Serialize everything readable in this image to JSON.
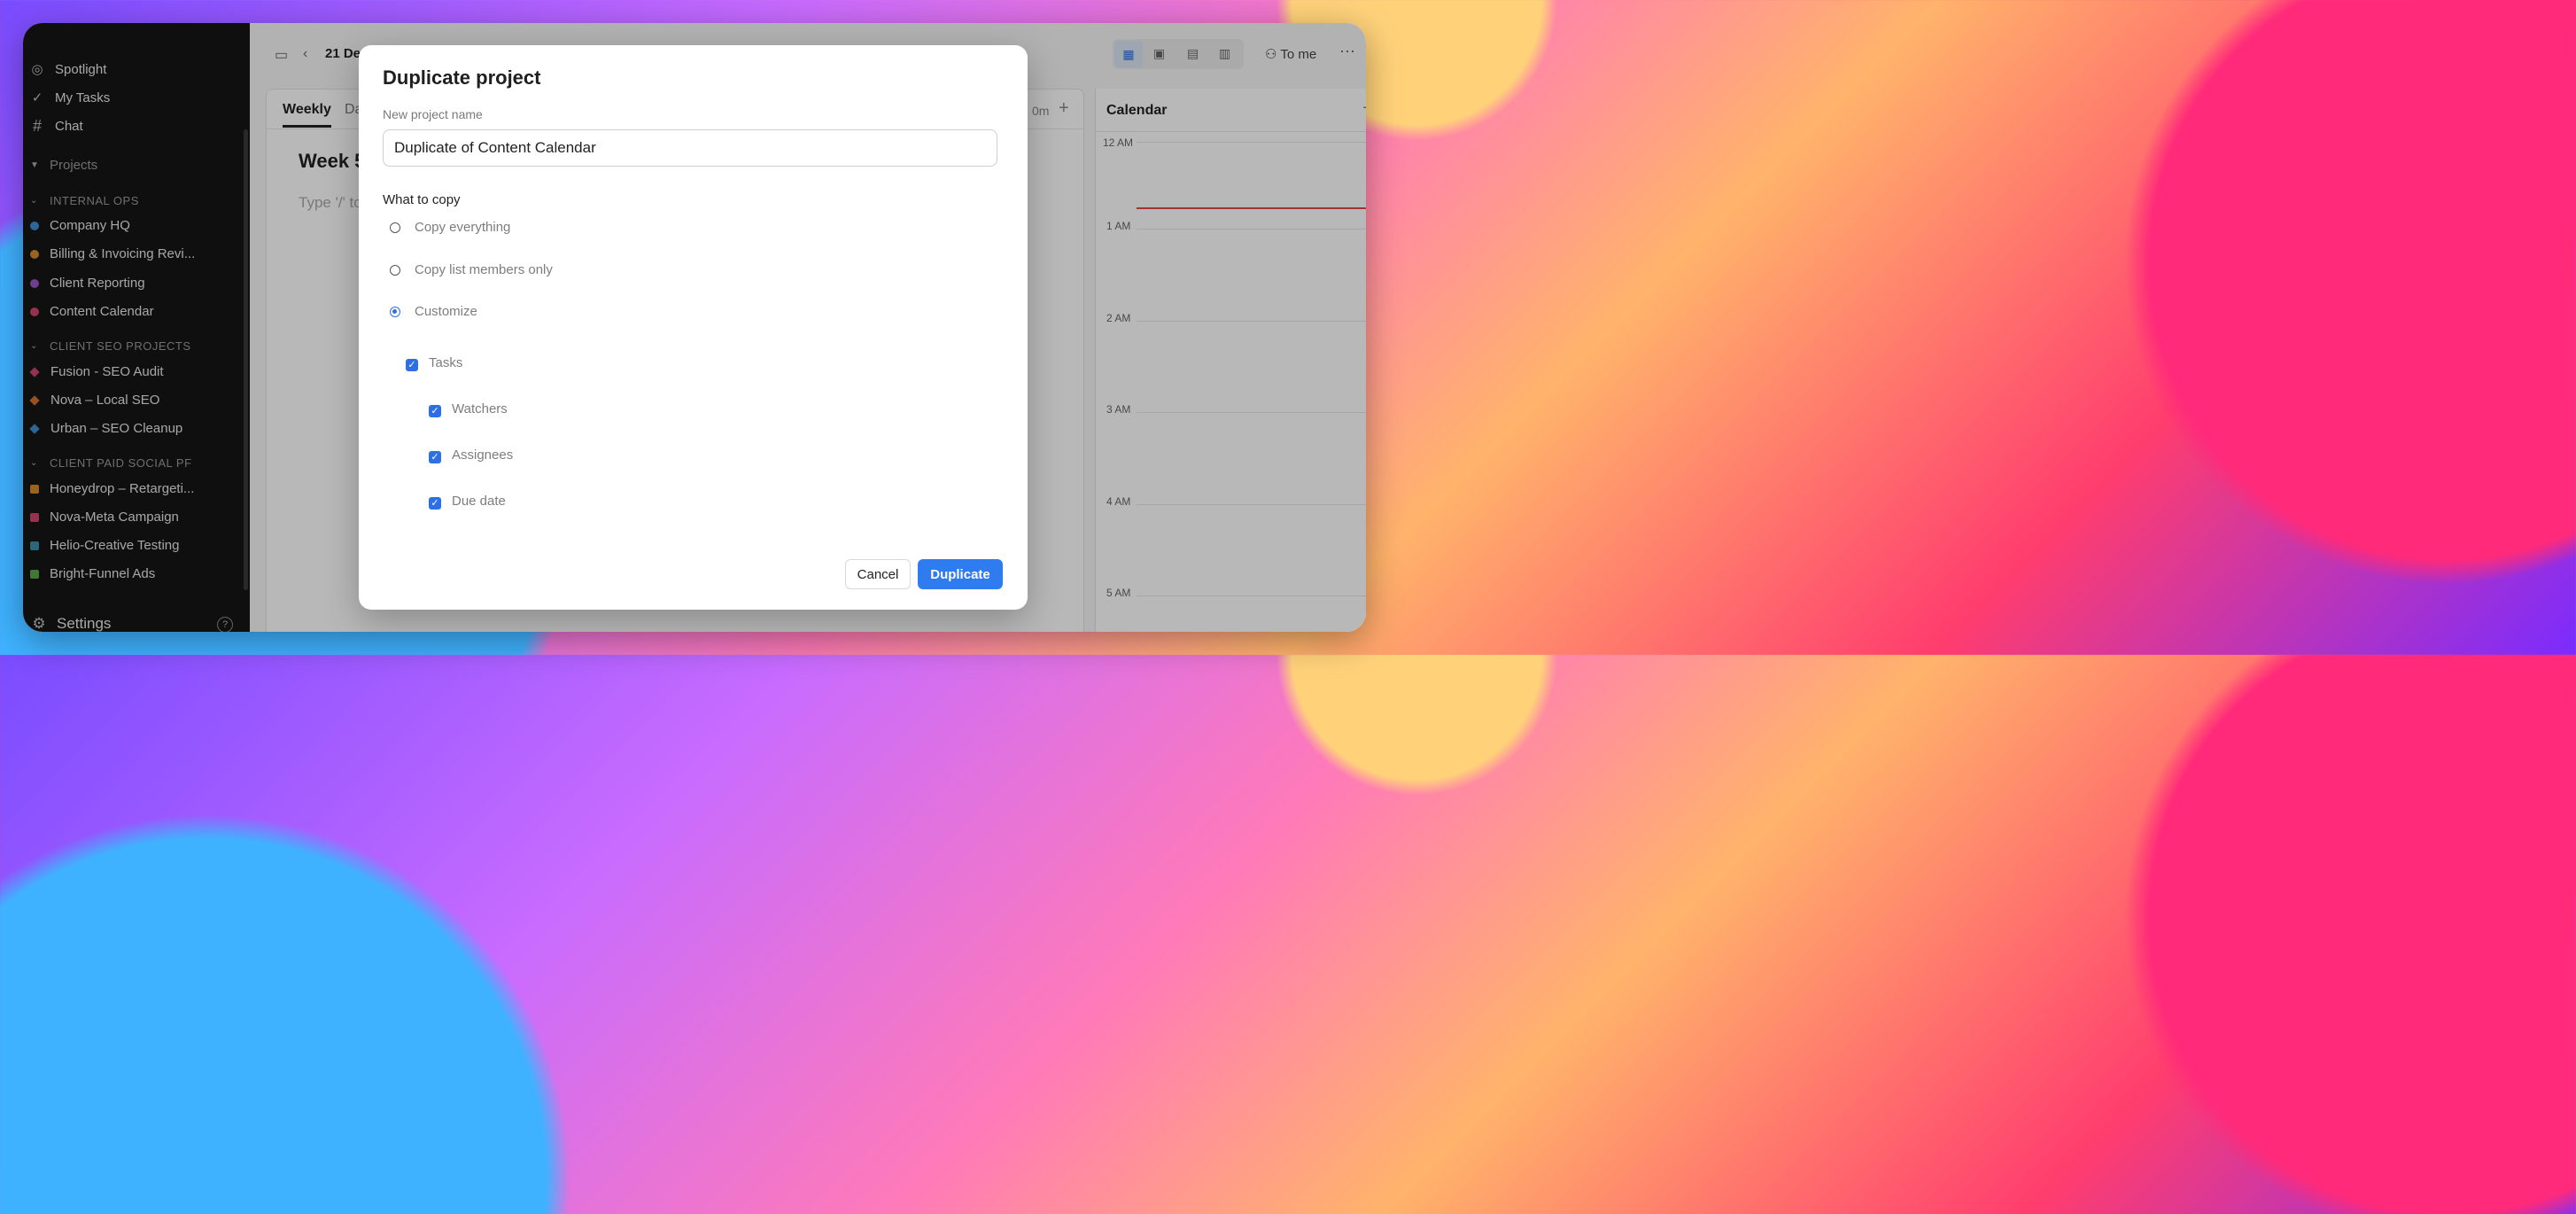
{
  "sidebar": {
    "nav": [
      {
        "label": "Spotlight",
        "icon": "spotlight-icon"
      },
      {
        "label": "My Tasks",
        "icon": "check-circle-icon"
      },
      {
        "label": "Chat",
        "icon": "hash-icon"
      }
    ],
    "projects_header": "Projects",
    "groups": [
      {
        "label": "INTERNAL OPS",
        "items": [
          {
            "label": "Company HQ",
            "color": "#3d8fd1",
            "shape": "dot"
          },
          {
            "label": "Billing & Invoicing Revi...",
            "color": "#d9892b",
            "shape": "dot"
          },
          {
            "label": "Client Reporting",
            "color": "#9a55c9",
            "shape": "dot"
          },
          {
            "label": "Content Calendar",
            "color": "#d0466f",
            "shape": "dot"
          }
        ]
      },
      {
        "label": "CLIENT SEO PROJECTS",
        "items": [
          {
            "label": "Fusion - SEO Audit",
            "color": "#d0466f",
            "shape": "diamond"
          },
          {
            "label": "Nova – Local SEO",
            "color": "#d9702b",
            "shape": "diamond"
          },
          {
            "label": "Urban – SEO Cleanup",
            "color": "#3d8fd1",
            "shape": "diamond"
          }
        ]
      },
      {
        "label": "CLIENT PAID SOCIAL PF",
        "items": [
          {
            "label": "Honeydrop – Retargeti...",
            "color": "#d9892b",
            "shape": "square"
          },
          {
            "label": "Nova-Meta Campaign",
            "color": "#d0466f",
            "shape": "square"
          },
          {
            "label": "Helio-Creative Testing",
            "color": "#3a8fa8",
            "shape": "square"
          },
          {
            "label": "Bright-Funnel Ads",
            "color": "#5aa64a",
            "shape": "square"
          }
        ]
      }
    ],
    "settings_label": "Settings",
    "help_label": "?"
  },
  "main": {
    "date_label": "21 De",
    "tabs": [
      "Weekly",
      "Da"
    ],
    "week_heading": "Week 5",
    "editor_placeholder": "Type '/' to",
    "time_label": "0m",
    "assign_label": "To me",
    "calendar_title": "Calendar",
    "hours": [
      "12 AM",
      "1 AM",
      "2 AM",
      "3 AM",
      "4 AM",
      "5 AM"
    ]
  },
  "modal": {
    "title": "Duplicate project",
    "name_label": "New project name",
    "name_value": "Duplicate of Content Calendar",
    "section_label": "What to copy",
    "options": [
      "Copy everything",
      "Copy list members only",
      "Customize"
    ],
    "selected_option": "Customize",
    "checks": {
      "tasks": "Tasks",
      "watchers": "Watchers",
      "assignees": "Assignees",
      "due_date": "Due date"
    },
    "cancel_label": "Cancel",
    "duplicate_label": "Duplicate"
  }
}
